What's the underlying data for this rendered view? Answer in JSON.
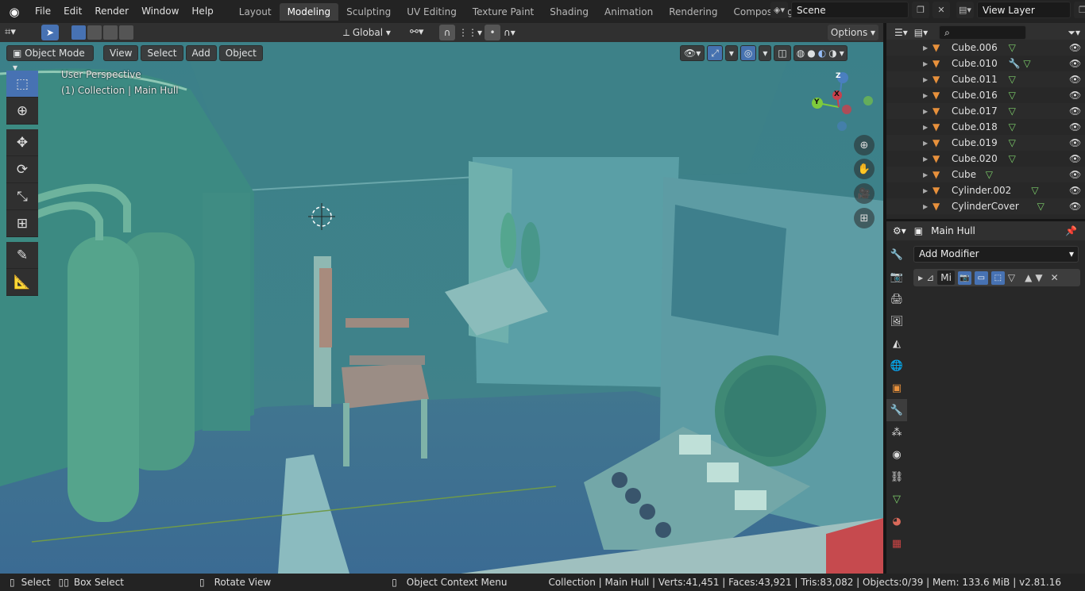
{
  "menu": [
    "File",
    "Edit",
    "Render",
    "Window",
    "Help"
  ],
  "workspaces": [
    "Layout",
    "Modeling",
    "Sculpting",
    "UV Editing",
    "Texture Paint",
    "Shading",
    "Animation",
    "Rendering",
    "Compositing",
    "Scripting"
  ],
  "active_workspace": "Modeling",
  "scene_name": "Scene",
  "view_layer": "View Layer",
  "header": {
    "orientation": "Global",
    "options": "Options"
  },
  "viewport": {
    "mode": "Object Mode",
    "menus": [
      "View",
      "Select",
      "Add",
      "Object"
    ],
    "perspective": "User Perspective",
    "collection_info": "(1) Collection | Main Hull",
    "gizmo": {
      "z": "Z",
      "y": "Y",
      "x": "X"
    }
  },
  "outliner": {
    "search_placeholder": "",
    "items": [
      {
        "name": "Cube.006"
      },
      {
        "name": "Cube.010"
      },
      {
        "name": "Cube.011"
      },
      {
        "name": "Cube.016"
      },
      {
        "name": "Cube.017"
      },
      {
        "name": "Cube.018"
      },
      {
        "name": "Cube.019"
      },
      {
        "name": "Cube.020"
      },
      {
        "name": "Cube"
      },
      {
        "name": "Cylinder.002"
      },
      {
        "name": "CylinderCover"
      }
    ]
  },
  "properties": {
    "object_name": "Main Hull",
    "add_modifier": "Add Modifier",
    "modifier_name": "Mi"
  },
  "status": {
    "select": "Select",
    "box_select": "Box Select",
    "rotate": "Rotate View",
    "context": "Object Context Menu",
    "stats": "Collection | Main Hull | Verts:41,451 | Faces:43,921 | Tris:83,082 | Objects:0/39 | Mem: 133.6 MiB | v2.81.16"
  },
  "colors": {
    "accent": "#4772b3",
    "mesh_icon": "#e8913c",
    "data_icon": "#7ed16b"
  }
}
